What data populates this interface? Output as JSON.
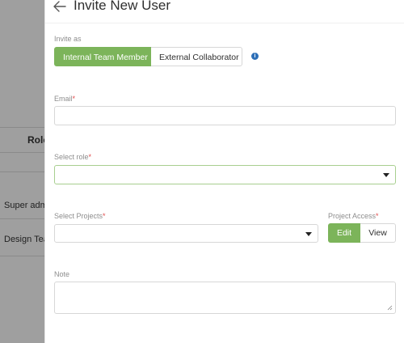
{
  "background": {
    "column_header": "Role",
    "rows": [
      "Super adm",
      "Design Tea"
    ]
  },
  "drawer": {
    "title": "Invite New User",
    "invite_as": {
      "label": "Invite as",
      "options": [
        "Internal Team Member",
        "External Collaborator"
      ],
      "selected": "Internal Team Member"
    },
    "email": {
      "label": "Email",
      "value": "",
      "required": true
    },
    "role": {
      "label": "Select role",
      "value": "",
      "required": true
    },
    "projects": {
      "label": "Select Projects",
      "value": "",
      "required": true
    },
    "project_access": {
      "label": "Project Access",
      "required": true,
      "options": [
        "Edit",
        "View"
      ],
      "selected": "Edit"
    },
    "note": {
      "label": "Note",
      "value": ""
    },
    "required_mark": "*",
    "info_icon_glyph": "i"
  },
  "colors": {
    "accent": "#7cb45a",
    "info": "#2d6fb7",
    "required": "#e04b4b"
  }
}
